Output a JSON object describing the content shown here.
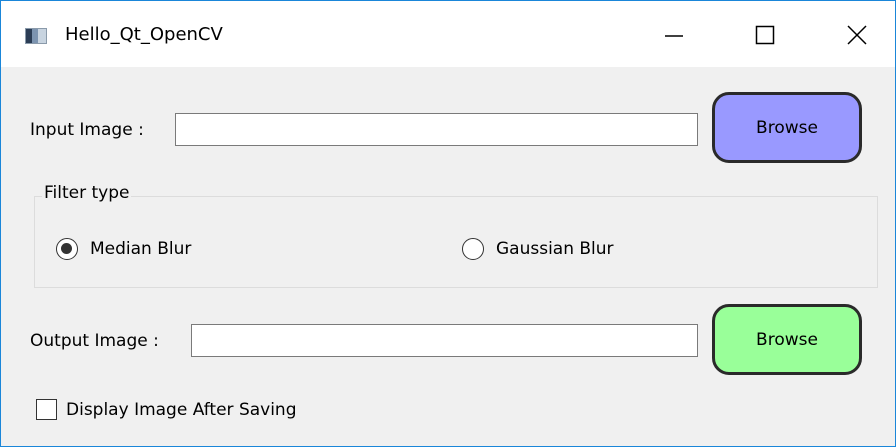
{
  "window": {
    "title": "Hello_Qt_OpenCV",
    "icon": "app-window-icon",
    "controls": [
      "minimize-icon",
      "maximize-icon",
      "close-icon"
    ]
  },
  "input": {
    "label": "Input Image :",
    "value": "",
    "browse_label": "Browse",
    "browse_color": "#9999ff"
  },
  "filter": {
    "group_title": "Filter type",
    "options": [
      {
        "label": "Median Blur",
        "selected": true
      },
      {
        "label": "Gaussian Blur",
        "selected": false
      }
    ]
  },
  "output": {
    "label": "Output Image :",
    "value": "",
    "browse_label": "Browse",
    "browse_color": "#99ff99"
  },
  "display_after_saving": {
    "label": "Display Image After Saving",
    "checked": false
  },
  "colors": {
    "window_border": "#1a86d9",
    "background": "#f0f0f0"
  }
}
